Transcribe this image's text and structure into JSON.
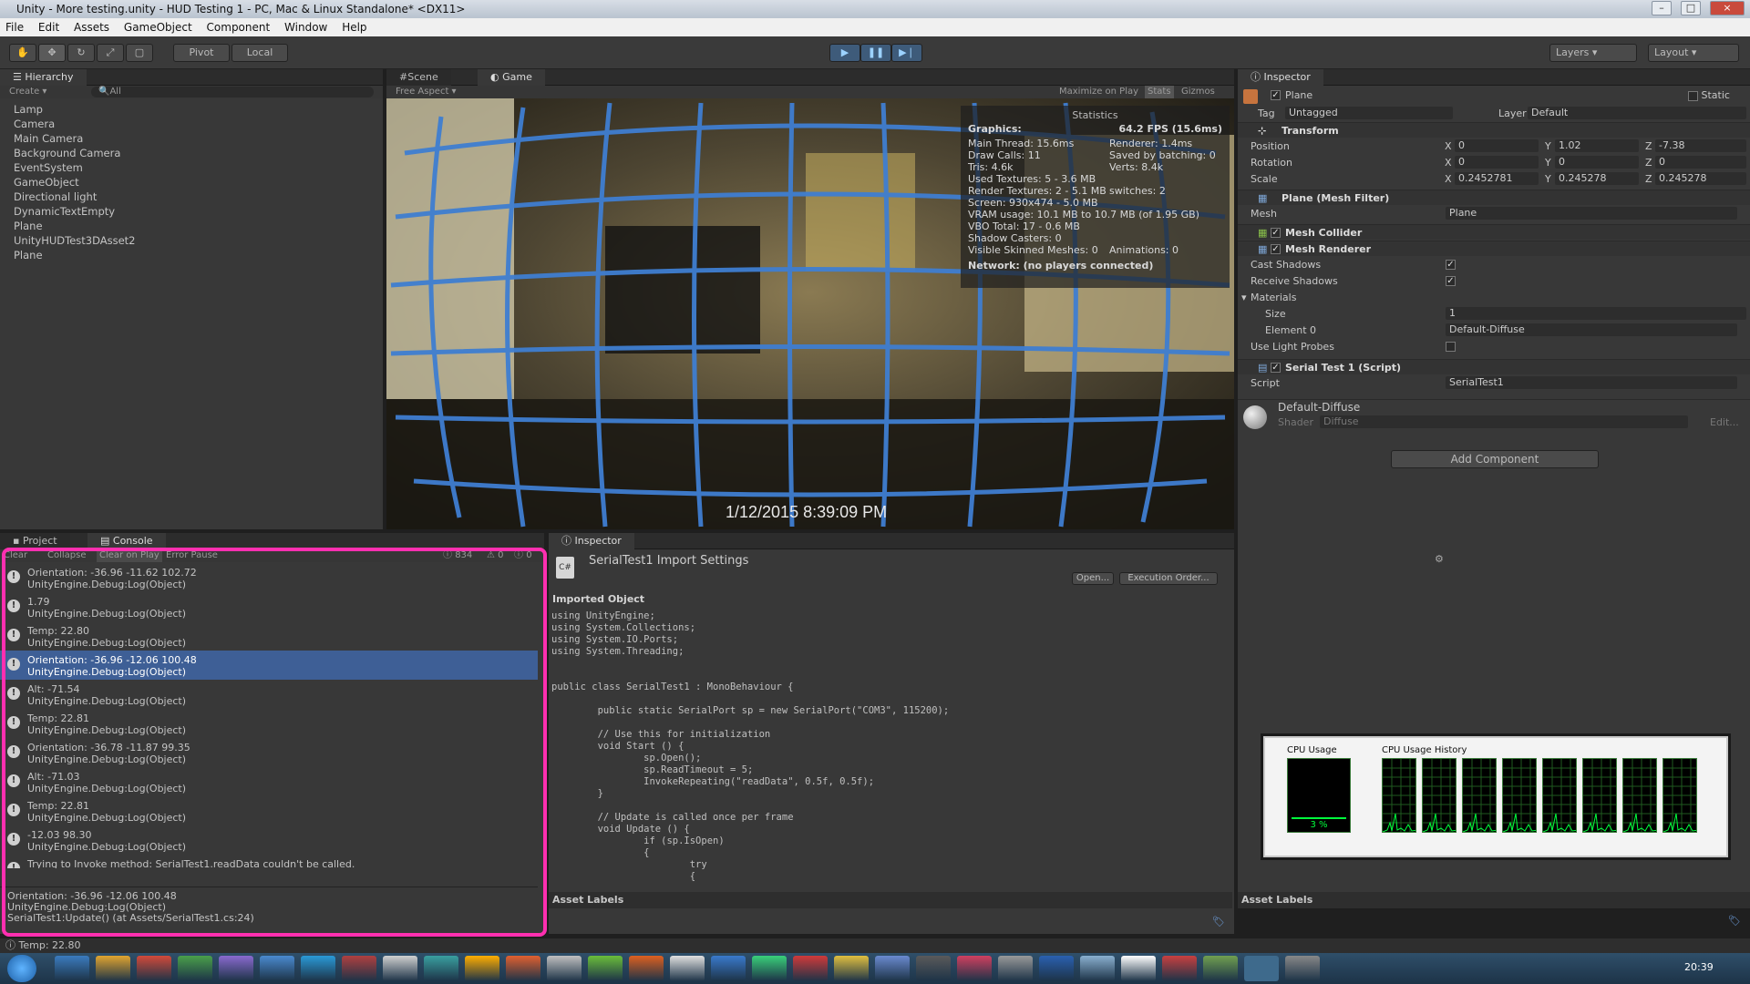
{
  "window": {
    "title": "Unity - More testing.unity - HUD Testing 1 - PC, Mac & Linux Standalone* <DX11>"
  },
  "menu": [
    "File",
    "Edit",
    "Assets",
    "GameObject",
    "Component",
    "Window",
    "Help"
  ],
  "toolbar": {
    "pivot": "Pivot",
    "local": "Local",
    "layers": "Layers",
    "layout": "Layout"
  },
  "hierarchy": {
    "tab": "Hierarchy",
    "create": "Create",
    "search": "All",
    "items": [
      "Lamp",
      "Camera",
      "Main Camera",
      "Background Camera",
      "EventSystem",
      "GameObject",
      "Directional light",
      "DynamicTextEmpty",
      "Plane",
      "UnityHUDTest3DAsset2",
      "Plane"
    ]
  },
  "game": {
    "scene_tab": "Scene",
    "game_tab": "Game",
    "aspect": "Free Aspect",
    "maximize": "Maximize on Play",
    "stats": "Stats",
    "gizmos": "Gizmos",
    "timestamp": "1/12/2015 8:39:09 PM"
  },
  "statistics": {
    "title": "Statistics",
    "graphics": "Graphics:",
    "fps": "64.2 FPS (15.6ms)",
    "lines": [
      [
        "Main Thread: 15.6ms",
        "Renderer: 1.4ms"
      ],
      [
        "Draw Calls: 11",
        "Saved by batching: 0"
      ],
      [
        "Tris: 4.6k",
        "Verts: 8.4k"
      ],
      [
        "Used Textures: 5 - 3.6 MB",
        ""
      ],
      [
        "Render Textures: 2 - 5.1 MB",
        "switches: 2"
      ],
      [
        "Screen: 930x474 - 5.0 MB",
        ""
      ],
      [
        "VRAM usage: 10.1 MB to 10.7 MB (of 1.95 GB)",
        ""
      ],
      [
        "VBO Total: 17 - 0.6 MB",
        ""
      ],
      [
        "Shadow Casters: 0",
        ""
      ],
      [
        "Visible Skinned Meshes: 0",
        "Animations: 0"
      ]
    ],
    "network": "Network: (no players connected)"
  },
  "inspector": {
    "tab": "Inspector",
    "object_name": "Plane",
    "static": "Static",
    "tag_label": "Tag",
    "tag": "Untagged",
    "layer_label": "Layer",
    "layer": "Default",
    "transform": "Transform",
    "position_label": "Position",
    "position": [
      "0",
      "1.02",
      "-7.38"
    ],
    "rotation_label": "Rotation",
    "rotation": [
      "0",
      "0",
      "0"
    ],
    "scale_label": "Scale",
    "scale": [
      "0.2452781",
      "0.245278",
      "0.245278"
    ],
    "mesh_filter": "Plane (Mesh Filter)",
    "mesh_label": "Mesh",
    "mesh": "Plane",
    "mesh_collider": "Mesh Collider",
    "mesh_renderer": "Mesh Renderer",
    "cast_shadows": "Cast Shadows",
    "receive_shadows": "Receive Shadows",
    "materials": "Materials",
    "size_label": "Size",
    "size": "1",
    "element0_label": "Element 0",
    "element0": "Default-Diffuse",
    "light_probes": "Use Light Probes",
    "script_comp": "Serial Test 1 (Script)",
    "script_label": "Script",
    "script": "SerialTest1",
    "material_name": "Default-Diffuse",
    "shader_label": "Shader",
    "shader": "Diffuse",
    "edit": "Edit...",
    "add_component": "Add Component",
    "asset_labels": "Asset Labels"
  },
  "console": {
    "project_tab": "Project",
    "console_tab": "Console",
    "buttons": [
      "Clear",
      "Collapse",
      "Clear on Play",
      "Error Pause"
    ],
    "count": "834",
    "warn_count": "0",
    "error_count": "0",
    "logs": [
      [
        "Orientation: -36.96 -11.62 102.72",
        "UnityEngine.Debug:Log(Object)"
      ],
      [
        "1.79",
        "UnityEngine.Debug:Log(Object)"
      ],
      [
        "Temp: 22.80",
        "UnityEngine.Debug:Log(Object)"
      ],
      [
        "Orientation: -36.96 -12.06 100.48",
        "UnityEngine.Debug:Log(Object)"
      ],
      [
        "Alt: -71.54",
        "UnityEngine.Debug:Log(Object)"
      ],
      [
        "Temp: 22.81",
        "UnityEngine.Debug:Log(Object)"
      ],
      [
        "Orientation: -36.78 -11.87 99.35",
        "UnityEngine.Debug:Log(Object)"
      ],
      [
        "Alt: -71.03",
        "UnityEngine.Debug:Log(Object)"
      ],
      [
        "Temp: 22.81",
        "UnityEngine.Debug:Log(Object)"
      ],
      [
        " -12.03 98.30",
        "UnityEngine.Debug:Log(Object)"
      ],
      [
        "Trying to Invoke method: SerialTest1.readData couldn't be called.",
        ""
      ]
    ],
    "selected_index": 3,
    "detail": [
      "Orientation: -36.96 -12.06 100.48",
      "UnityEngine.Debug:Log(Object)",
      "SerialTest1:Update() (at Assets/SerialTest1.cs:24)"
    ]
  },
  "script_inspector": {
    "tab": "Inspector",
    "title": "SerialTest1 Import Settings",
    "open": "Open...",
    "exec_order": "Execution Order...",
    "imported": "Imported Object",
    "asset_labels": "Asset Labels",
    "code": "using UnityEngine;\nusing System.Collections;\nusing System.IO.Ports;\nusing System.Threading;\n\n\npublic class SerialTest1 : MonoBehaviour {\n\n\tpublic static SerialPort sp = new SerialPort(\"COM3\", 115200);\n\n\t// Use this for initialization\n\tvoid Start () {\n\t\tsp.Open();\n\t\tsp.ReadTimeout = 5;\n\t\tInvokeRepeating(\"readData\", 0.5f, 0.5f);\n\t}\n\n\t// Update is called once per frame\n\tvoid Update () {\n\t\tif (sp.IsOpen)\n\t\t{\n\t\t\ttry\n\t\t\t{"
  },
  "statusbar": "Temp: 22.80",
  "cpu": {
    "usage_title": "CPU Usage",
    "history_title": "CPU Usage History",
    "usage": "3 %",
    "usage_fraction": 0.03
  },
  "clock": "20:39",
  "colors": {
    "accent": "#3e5f96",
    "highlight": "#ff2fb0",
    "play": "#3e5b7a"
  }
}
